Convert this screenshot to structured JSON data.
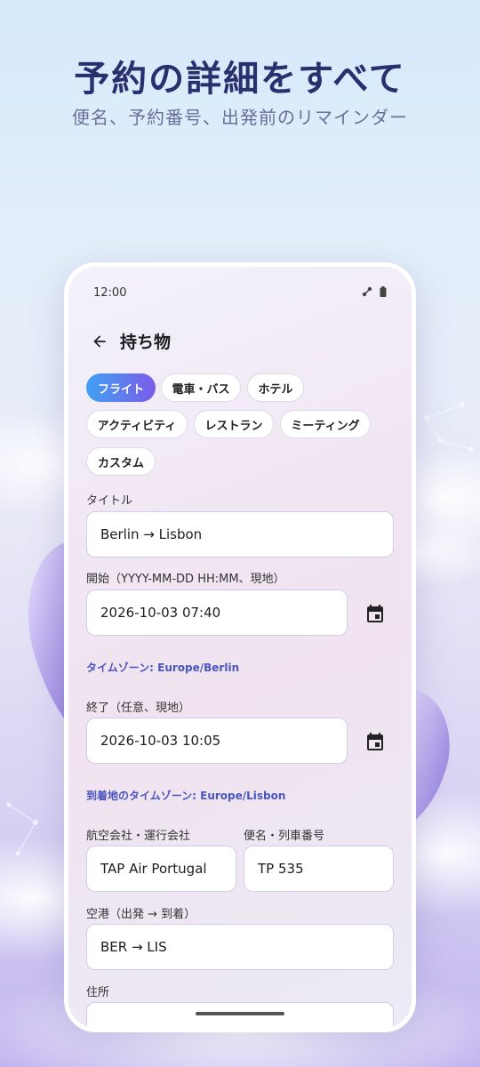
{
  "hero": {
    "title": "予約の詳細をすべて",
    "subtitle": "便名、予約番号、出発前のリマインダー"
  },
  "status": {
    "time": "12:00"
  },
  "appbar": {
    "title": "持ち物"
  },
  "chips": [
    "フライト",
    "電車・バス",
    "ホテル",
    "アクティビティ",
    "レストラン",
    "ミーティング",
    "カスタム"
  ],
  "selected_chip": "フライト",
  "form": {
    "title_label": "タイトル",
    "title_value": "Berlin → Lisbon",
    "start_label": "開始（YYYY-MM-DD HH:MM、現地）",
    "start_value": "2026-10-03 07:40",
    "start_tz": "タイムゾーン: Europe/Berlin",
    "end_label": "終了（任意、現地）",
    "end_value": "2026-10-03 10:05",
    "end_tz": "到着地のタイムゾーン: Europe/Lisbon",
    "airline_label": "航空会社・運行会社",
    "airline_value": "TAP Air Portugal",
    "flight_label": "便名・列車番号",
    "flight_value": "TP 535",
    "airport_label": "空港（出発 → 到着）",
    "airport_value": "BER → LIS",
    "address_label": "住所",
    "address_value": ""
  },
  "icons": {
    "back": "arrow-left-icon",
    "calendar": "calendar-icon",
    "signal": "signal-icon",
    "battery": "battery-icon"
  },
  "colors": {
    "accent_start": "#3fa0f2",
    "accent_end": "#7c5ce8",
    "timezone_text": "#4a55c0",
    "hero_title": "#2a2f6e"
  }
}
